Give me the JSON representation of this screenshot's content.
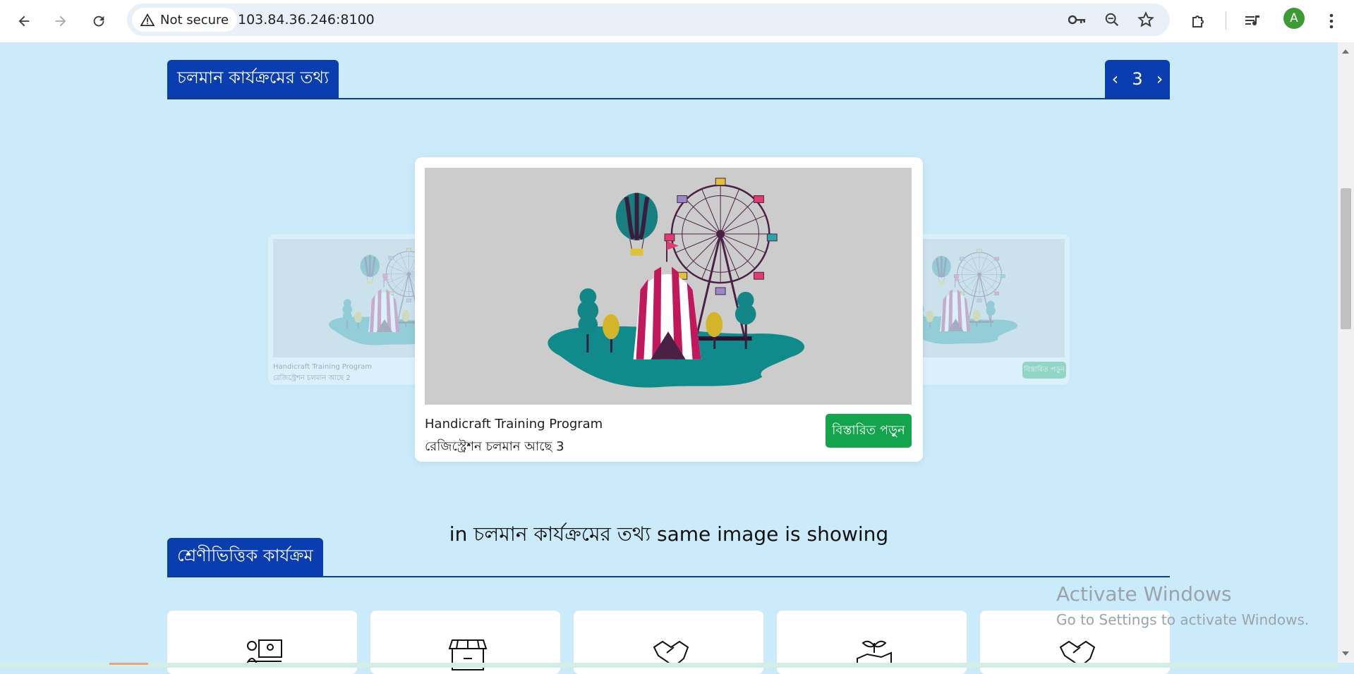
{
  "browser": {
    "security_label": "Not secure",
    "url": "103.84.36.246:8100",
    "profile_initial": "A",
    "icons": [
      "back-arrow-icon",
      "forward-arrow-icon",
      "reload-icon",
      "warning-icon",
      "key-icon",
      "zoom-icon",
      "star-icon",
      "extensions-icon",
      "media-icon",
      "menu-icon"
    ]
  },
  "running_section": {
    "title": "চলমান কার্যক্রমের তথ্য",
    "pager_prev": "‹",
    "pager_page": "3",
    "pager_next": "›"
  },
  "carousel": {
    "left_card": {
      "title": "Handicraft Training Program",
      "status": "রেজিস্ট্রেশন চলমান আছে 2"
    },
    "center_card": {
      "title": "Handicraft Training Program",
      "status": "রেজিস্ট্রেশন চলমান আছে 3",
      "button": "বিস্তারিত পড়ুন"
    },
    "right_card": {
      "button": "বিস্তারিত পড়ুন"
    }
  },
  "note": "in চলমান কার্যক্রমের তথ্য same image is showing",
  "category_section": {
    "title": "শ্রেণীভিত্তিক কার্যক্রম",
    "cards": [
      "training-icon",
      "shop-icon",
      "handshake-icon",
      "plant-hand-icon",
      "handshake-icon"
    ]
  },
  "watermark": {
    "line1": "Activate Windows",
    "line2": "Go to Settings to activate Windows."
  },
  "colors": {
    "page_bg": "#cbebfb",
    "header_blue": "#0a3db0",
    "button_green": "#14a44d"
  }
}
